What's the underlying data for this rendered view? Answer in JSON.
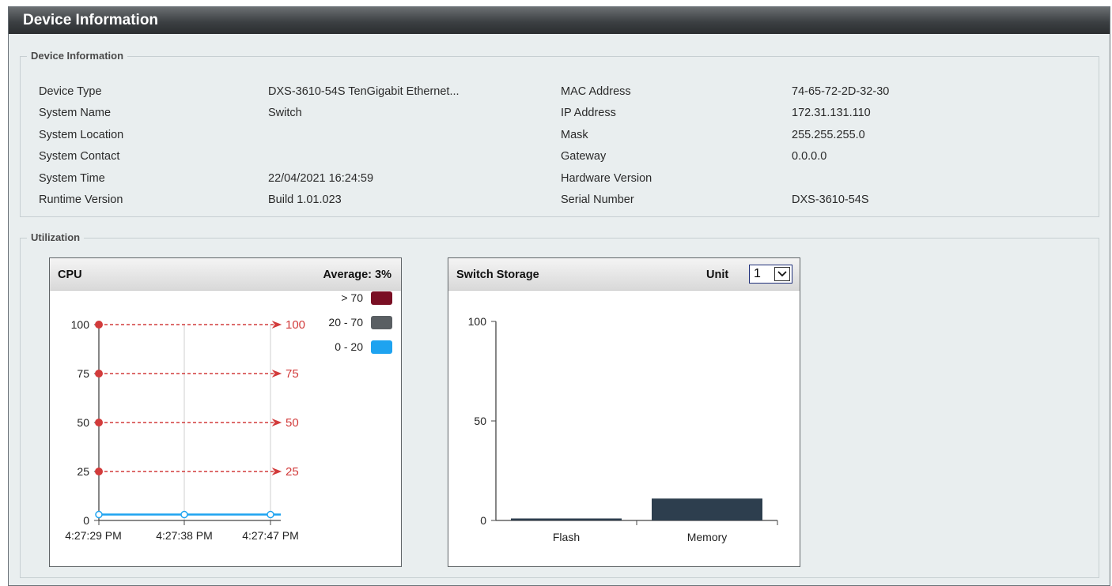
{
  "window": {
    "title": "Device Information"
  },
  "device_info": {
    "legend": "Device Information",
    "left": [
      {
        "label": "Device Type",
        "value": "DXS-3610-54S TenGigabit Ethernet..."
      },
      {
        "label": "System Name",
        "value": "Switch"
      },
      {
        "label": "System Location",
        "value": ""
      },
      {
        "label": "System Contact",
        "value": ""
      },
      {
        "label": "System Time",
        "value": "22/04/2021 16:24:59"
      },
      {
        "label": "Runtime Version",
        "value": "Build 1.01.023"
      }
    ],
    "right": [
      {
        "label": "MAC Address",
        "value": "74-65-72-2D-32-30"
      },
      {
        "label": "IP Address",
        "value": "172.31.131.110"
      },
      {
        "label": "Mask",
        "value": "255.255.255.0"
      },
      {
        "label": "Gateway",
        "value": "0.0.0.0"
      },
      {
        "label": "Hardware Version",
        "value": ""
      },
      {
        "label": "Serial Number",
        "value": "DXS-3610-54S"
      }
    ]
  },
  "utilization": {
    "legend": "Utilization",
    "cpu": {
      "title": "CPU",
      "average_label": "Average: 3%",
      "legend_items": [
        {
          "label": "> 70",
          "color": "#7a0f24"
        },
        {
          "label": "20 - 70",
          "color": "#5a5f63"
        },
        {
          "label": "0 - 20",
          "color": "#1ea3f0"
        }
      ],
      "threshold_lines": [
        "100",
        "75",
        "50",
        "25"
      ],
      "y_ticks": [
        "0",
        "25",
        "50",
        "75",
        "100"
      ],
      "x_ticks": [
        "4:27:29 PM",
        "4:27:38 PM",
        "4:27:47 PM"
      ],
      "series": [
        3,
        3,
        3
      ]
    },
    "storage": {
      "title": "Switch Storage",
      "unit_label": "Unit",
      "unit_value": "1",
      "y_ticks": [
        "0",
        "50",
        "100"
      ],
      "bar_color": "#2d3e4e"
    }
  },
  "chart_data": [
    {
      "type": "line",
      "title": "CPU",
      "x": [
        "4:27:29 PM",
        "4:27:38 PM",
        "4:27:47 PM"
      ],
      "series": [
        {
          "values": [
            3,
            3,
            3
          ]
        }
      ],
      "ylim": [
        0,
        100
      ],
      "yticks": [
        0,
        25,
        50,
        75,
        100
      ],
      "annotations": [
        "100",
        "75",
        "50",
        "25"
      ]
    },
    {
      "type": "bar",
      "title": "Switch Storage",
      "categories": [
        "Flash",
        "Memory"
      ],
      "values": [
        1,
        11
      ],
      "ylim": [
        0,
        100
      ],
      "yticks": [
        0,
        50,
        100
      ]
    }
  ]
}
